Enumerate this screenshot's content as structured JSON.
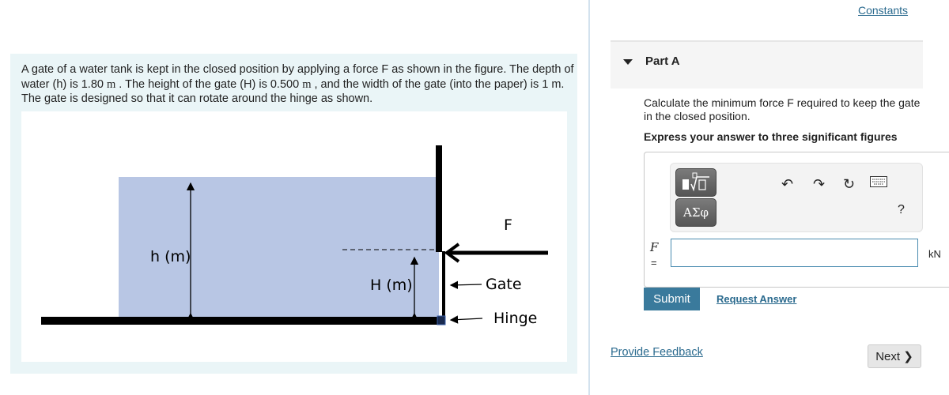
{
  "problem": {
    "text_1": "A gate of a water tank is kept in the closed position by applying a force F as shown in the figure. The depth of water (h) is 1.80 ",
    "unit_h": "m",
    "text_2": " . The height of the gate (H) is 0.500 ",
    "unit_H": "m",
    "text_3": " , and the width of the gate (into the paper) is 1 m. The gate is designed so that it can rotate around the hinge as shown.",
    "figure": {
      "label_h": "h (m)",
      "label_H": "H (m)",
      "label_F": "F",
      "label_gate": "Gate",
      "label_hinge": "Hinge",
      "water_color": "#b8c6e4"
    }
  },
  "header": {
    "constants_link": "Constants"
  },
  "part": {
    "title": "Part A",
    "question": "Calculate the minimum force F required to keep the gate in the closed position.",
    "instruction": "Express your answer to three significant figures",
    "toolbar": {
      "template_icon": "fraction-root-template-icon",
      "greek_label": "ΑΣφ",
      "undo_icon": "undo-icon",
      "redo_icon": "redo-icon",
      "reset_icon": "reset-icon",
      "keyboard_icon": "keyboard-icon",
      "help_label": "?"
    },
    "variable": "F",
    "equals": "=",
    "answer_value": "",
    "unit": "kN",
    "submit_label": "Submit",
    "request_answer_label": "Request Answer"
  },
  "footer": {
    "feedback_link": "Provide Feedback",
    "next_label": "Next ❯"
  },
  "colors": {
    "accent": "#3a7a9c",
    "link": "#2a6a8e",
    "panel_bg": "#eaf5f7"
  }
}
